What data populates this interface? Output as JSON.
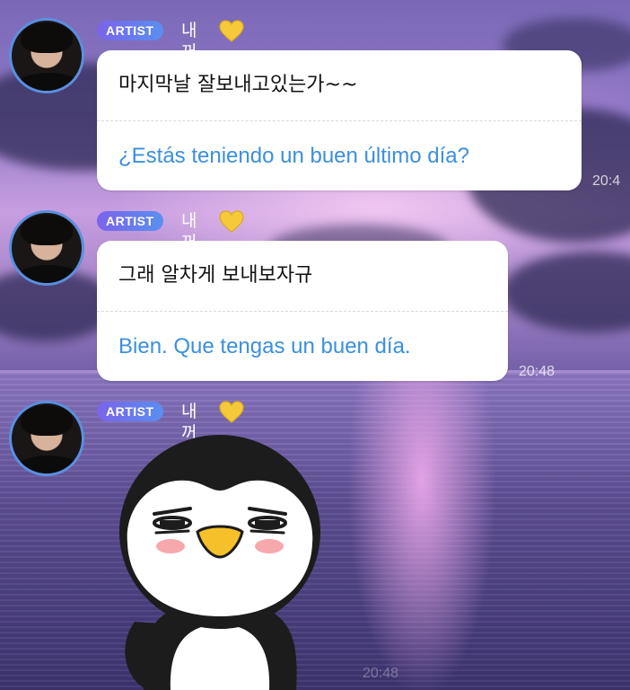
{
  "colors": {
    "badge_gradient": [
      "#7b63e8",
      "#5a8ff0"
    ],
    "translation_text": "#3b8fe0",
    "avatar_ring": "#5a8fe0",
    "heart": "#f5c93a"
  },
  "messages": [
    {
      "badge": "ARTIST",
      "name": "내꺼",
      "icon": "yellow-heart-icon",
      "original": "마지막날 잘보내고있는가~~",
      "translation": "¿Estás teniendo un buen último día?",
      "time": "20:4"
    },
    {
      "badge": "ARTIST",
      "name": "내꺼",
      "icon": "yellow-heart-icon",
      "original": "그래 알차게 보내보자규",
      "translation": "Bien. Que tengas un buen día.",
      "time": "20:48"
    },
    {
      "badge": "ARTIST",
      "name": "내꺼",
      "icon": "yellow-heart-icon",
      "sticker": "penguin-sticker",
      "time": "20:48"
    }
  ]
}
